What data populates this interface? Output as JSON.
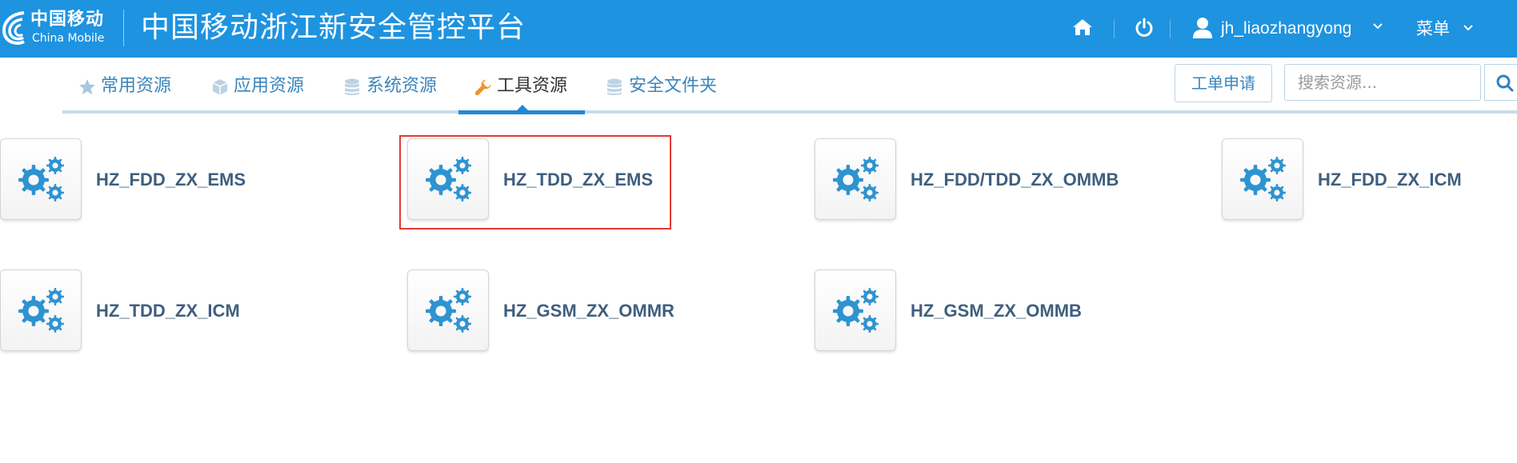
{
  "header": {
    "logo_cn": "中国移动",
    "logo_en": "China Mobile",
    "title": "中国移动浙江新安全管控平台",
    "home_icon": "home-icon",
    "power_icon": "power-icon",
    "user_icon": "user-icon",
    "username": "jh_liaozhangyong",
    "menu_label": "菜单"
  },
  "nav": {
    "tabs": [
      {
        "label": "常用资源",
        "icon": "star-icon",
        "active": false
      },
      {
        "label": "应用资源",
        "icon": "cube-icon",
        "active": false
      },
      {
        "label": "系统资源",
        "icon": "database-icon",
        "active": false
      },
      {
        "label": "工具资源",
        "icon": "wrench-icon",
        "active": true
      },
      {
        "label": "安全文件夹",
        "icon": "database-icon",
        "active": false
      }
    ],
    "ticket_button": "工单申请",
    "search_placeholder": "搜索资源...",
    "search_icon": "search-icon"
  },
  "resources": [
    {
      "name": "HZ_FDD_ZX_EMS",
      "icon": "gears-icon",
      "selected": false
    },
    {
      "name": "HZ_TDD_ZX_EMS",
      "icon": "gears-icon",
      "selected": true
    },
    {
      "name": "HZ_FDD/TDD_ZX_OMMB",
      "icon": "gears-icon",
      "selected": false
    },
    {
      "name": "HZ_FDD_ZX_ICM",
      "icon": "gears-icon",
      "selected": false
    },
    {
      "name": "HZ_TDD_ZX_ICM",
      "icon": "gears-icon",
      "selected": false
    },
    {
      "name": "HZ_GSM_ZX_OMMR",
      "icon": "gears-icon",
      "selected": false
    },
    {
      "name": "HZ_GSM_ZX_OMMB",
      "icon": "gears-icon",
      "selected": false
    }
  ],
  "colors": {
    "header_bg": "#1e93e0",
    "link": "#3a86bd",
    "resource_name": "#3f5f7e",
    "gear": "#2e93d1",
    "selection": "#e53935",
    "wrench": "#f0932b"
  }
}
